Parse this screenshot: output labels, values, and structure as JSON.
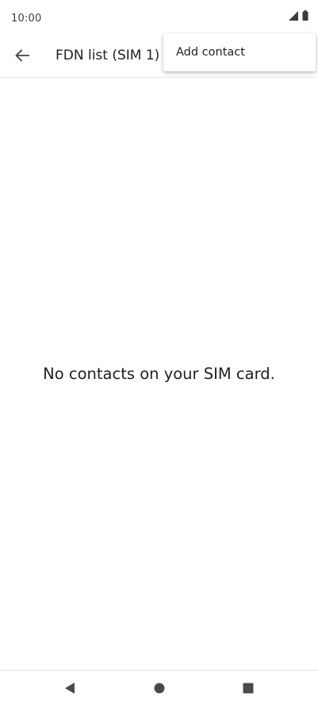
{
  "status_bar": {
    "time": "10:00",
    "icons": [
      "cellular-signal-icon",
      "battery-icon"
    ]
  },
  "app_bar": {
    "back_icon": "arrow-back-icon",
    "title": "FDN list (SIM 1)"
  },
  "overflow_menu": {
    "items": [
      {
        "label": "Add contact"
      }
    ]
  },
  "main": {
    "empty_message": "No contacts on your SIM card."
  },
  "nav_bar": {
    "icons": [
      "nav-back-icon",
      "nav-home-icon",
      "nav-recents-icon"
    ]
  },
  "colors": {
    "background": "#ffffff",
    "text": "#1f1f1f",
    "icon": "#424242",
    "divider": "#e6e6e6"
  }
}
